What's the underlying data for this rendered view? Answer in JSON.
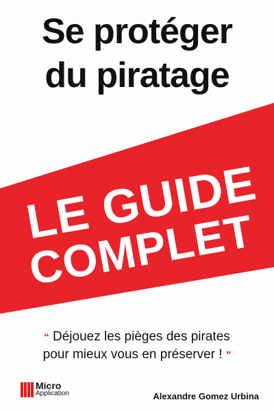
{
  "cover": {
    "title_line1": "Se protéger",
    "title_line2": "du piratage",
    "banner_line1": "LE GUIDE",
    "banner_line2": "COMPLET",
    "quote_open": "“",
    "quote_line1": "Déjouez les pièges des pirates",
    "quote_line2": "pour mieux vous en préserver !",
    "quote_close": "”",
    "publisher_line1": "Micro",
    "publisher_line2": "Application",
    "author": "Alexandre Gomez Urbina"
  },
  "colors": {
    "banner_red": "#e8232a",
    "accent_red": "#e01a1a",
    "text": "#111111",
    "background": "#fdfdfd"
  }
}
